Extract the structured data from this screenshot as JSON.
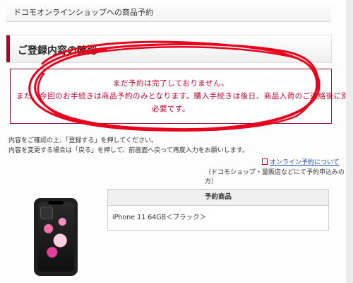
{
  "header": {
    "title": "ドコモオンラインショップへの商品予約"
  },
  "section": {
    "heading": "ご登録内容の確認"
  },
  "notice": {
    "line1": "まだ予約は完了しておりません。",
    "line2": "また、今回のお手続きは商品予約のみとなります。購入手続きは後日、商品入荷のご連絡後に別途",
    "line3": "必要です。"
  },
  "instructions": {
    "line1": "内容をご確認の上、「登録する」を押してください。",
    "line2": "内容を変更する場合は「戻る」を押して、前画面へ戻って再度入力をお願いします。"
  },
  "links": {
    "online_reservation": "オンライン予約について",
    "note": "（ドコモショップ・量販店などにて予約申込みの方）"
  },
  "product_table": {
    "header": "予約商品",
    "item": "iPhone 11 64GB＜ブラック＞"
  },
  "colors": {
    "accent": "#b0002a",
    "notice_text": "#c4002d",
    "scribble": "#e8001c"
  }
}
